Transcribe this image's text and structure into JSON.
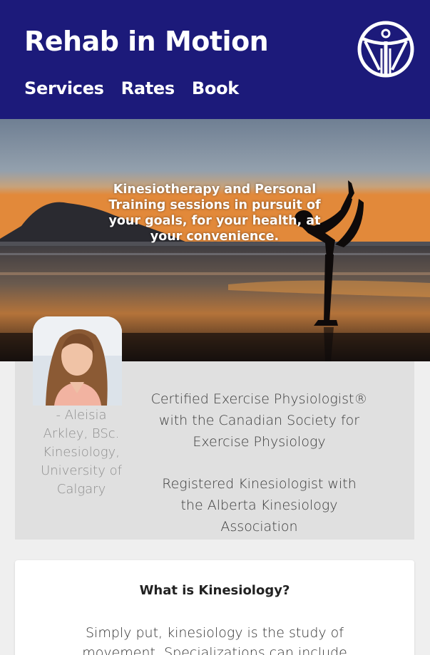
{
  "header": {
    "title": "Rehab in Motion",
    "nav": [
      "Services",
      "Rates",
      "Book"
    ],
    "logo_icon": "figure-in-circle-logo-icon",
    "background_color": "#1c1a7a"
  },
  "hero": {
    "tagline": "Kinesiotherapy and Personal Training sessions in pursuit of your goals, for your health, at your convenience.",
    "image": "yoga-silhouette-beach-sunset-photo"
  },
  "profile": {
    "photo": "aleisia-portrait-photo",
    "caption": "- Aleisia Arkley, BSc. Kinesiology, University of Calgary",
    "credentials": [
      "Certified Exercise Physiologist® with the Canadian Society for Exercise Physiology",
      "Registered Kinesiologist with the Alberta Kinesiology Association"
    ]
  },
  "about": {
    "title": "What is Kinesiology?",
    "body": "Simply put, kinesiology is the study of movement. Specializations can include anything under the"
  }
}
